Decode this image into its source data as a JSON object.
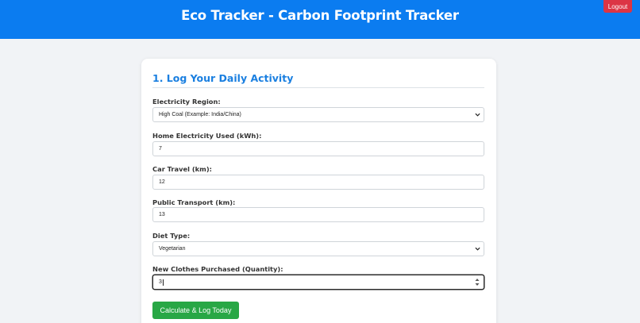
{
  "header": {
    "title": "Eco Tracker - Carbon Footprint Tracker",
    "logout_label": "Logout",
    "bg_color": "#0b7cf0"
  },
  "form": {
    "title": "1. Log Your Daily Activity",
    "electricity_region": {
      "label": "Electricity Region:",
      "value": "High Coal (Example: India/China)"
    },
    "home_electricity": {
      "label": "Home Electricity Used (kWh):",
      "value": "7"
    },
    "car_travel": {
      "label": "Car Travel (km):",
      "value": "12"
    },
    "public_transport": {
      "label": "Public Transport (km):",
      "value": "13"
    },
    "diet_type": {
      "label": "Diet Type:",
      "value": "Vegetarian"
    },
    "new_clothes": {
      "label": "New Clothes Purchased (Quantity):",
      "value": "3"
    },
    "submit_label": "Calculate & Log Today"
  },
  "colors": {
    "accent": "#1a7fe0",
    "logout": "#dc3545",
    "submit": "#28a745",
    "page_bg": "#f1f3f6"
  },
  "icons": [
    "chevron-down-icon",
    "spinner-arrows-icon"
  ]
}
